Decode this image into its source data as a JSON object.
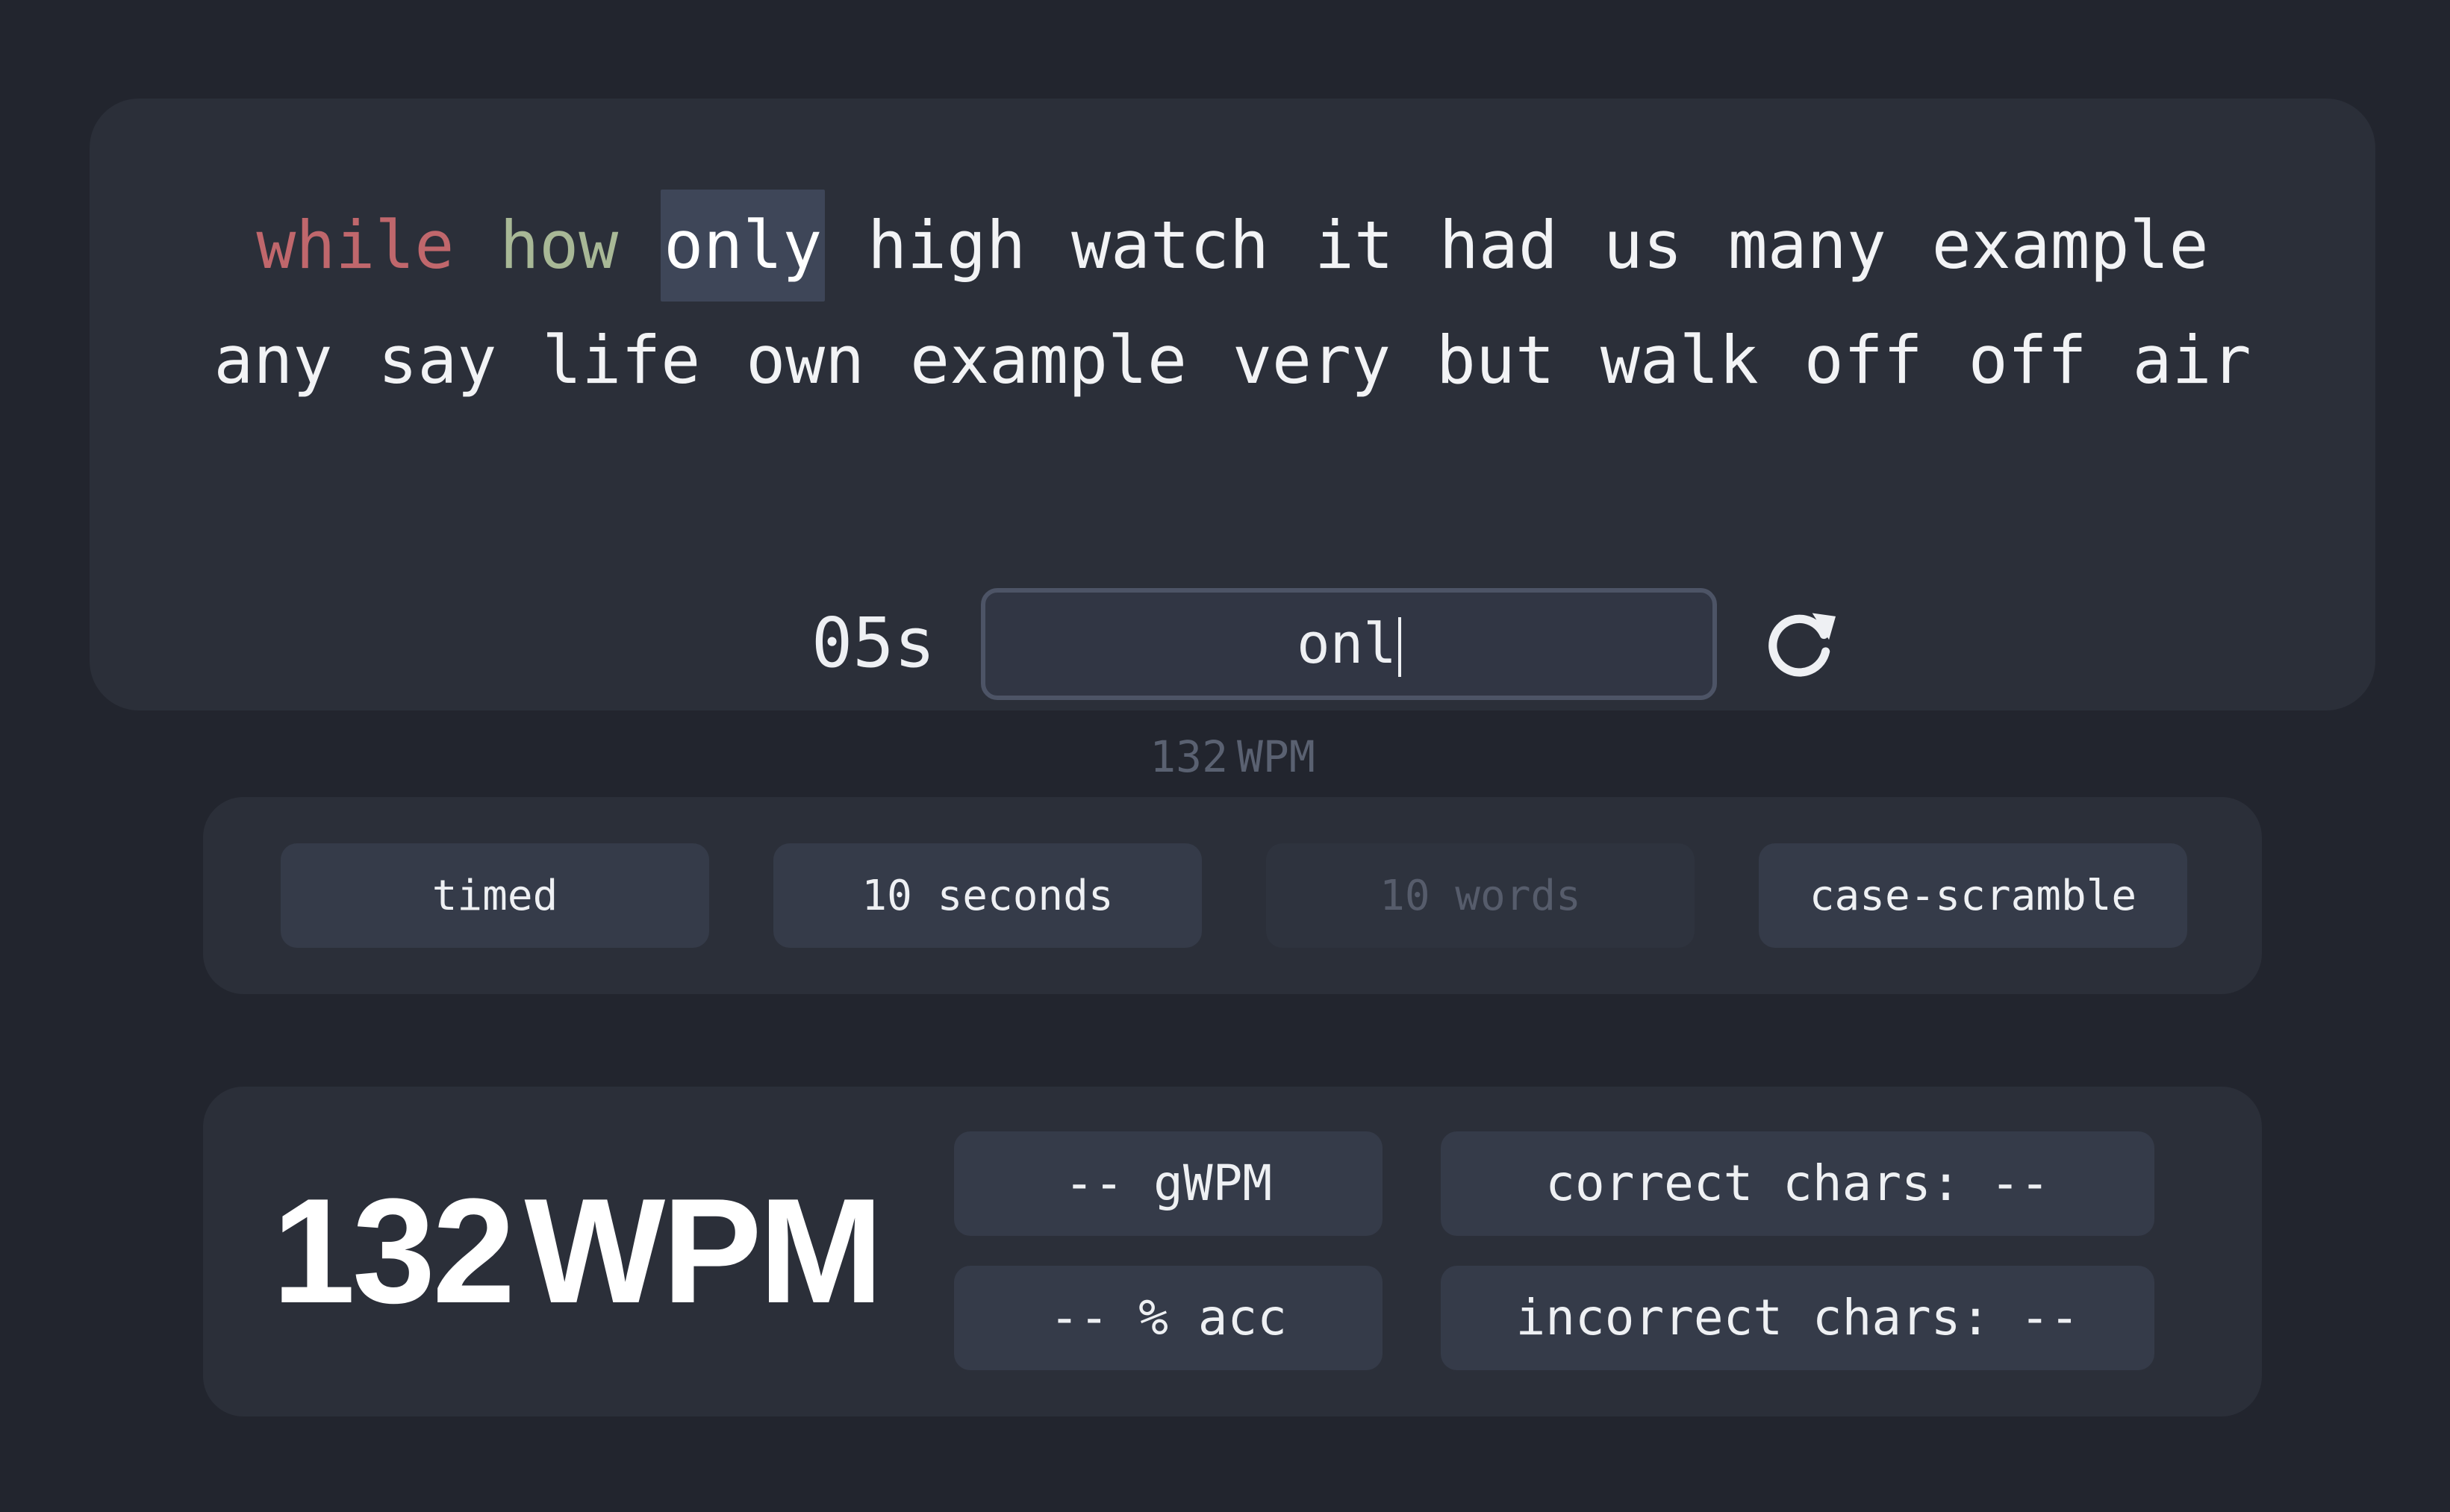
{
  "typing": {
    "line1": {
      "w0": "while",
      "w1": "how",
      "w2": "only",
      "w3": "high",
      "w4": "watch",
      "w5": "it",
      "w6": "had",
      "w7": "us",
      "w8": "many",
      "w9": "example"
    },
    "line2": {
      "w0": "any",
      "w1": "say",
      "w2": "life",
      "w3": "own",
      "w4": "example",
      "w5": "very",
      "w6": "but",
      "w7": "walk",
      "w8": "off",
      "w9": "off",
      "w10": "air"
    },
    "word_states": {
      "incorrect": "while",
      "correct": "how",
      "current": "only"
    },
    "timer": "05s",
    "input_value": "onl",
    "live_wpm_value": "132",
    "live_wpm_unit": "WPM"
  },
  "options": {
    "mode": "timed",
    "duration": "10 seconds",
    "word_count": "10 words",
    "word_count_disabled": true,
    "modifier": "case-scramble"
  },
  "results": {
    "wpm_value": "132",
    "wpm_unit": "WPM",
    "gwpm": "-- gWPM",
    "accuracy": "-- % acc",
    "correct_chars": "correct chars: --",
    "incorrect_chars": "incorrect chars: --"
  },
  "colors": {
    "background": "#22252e",
    "panel": "#2b2f39",
    "button": "#353b49",
    "incorrect_word": "#c0676c",
    "correct_word": "#a8b896",
    "current_word_highlight": "#3e4658",
    "muted_text": "#5a6171"
  },
  "icons": {
    "restart": "restart-icon"
  }
}
